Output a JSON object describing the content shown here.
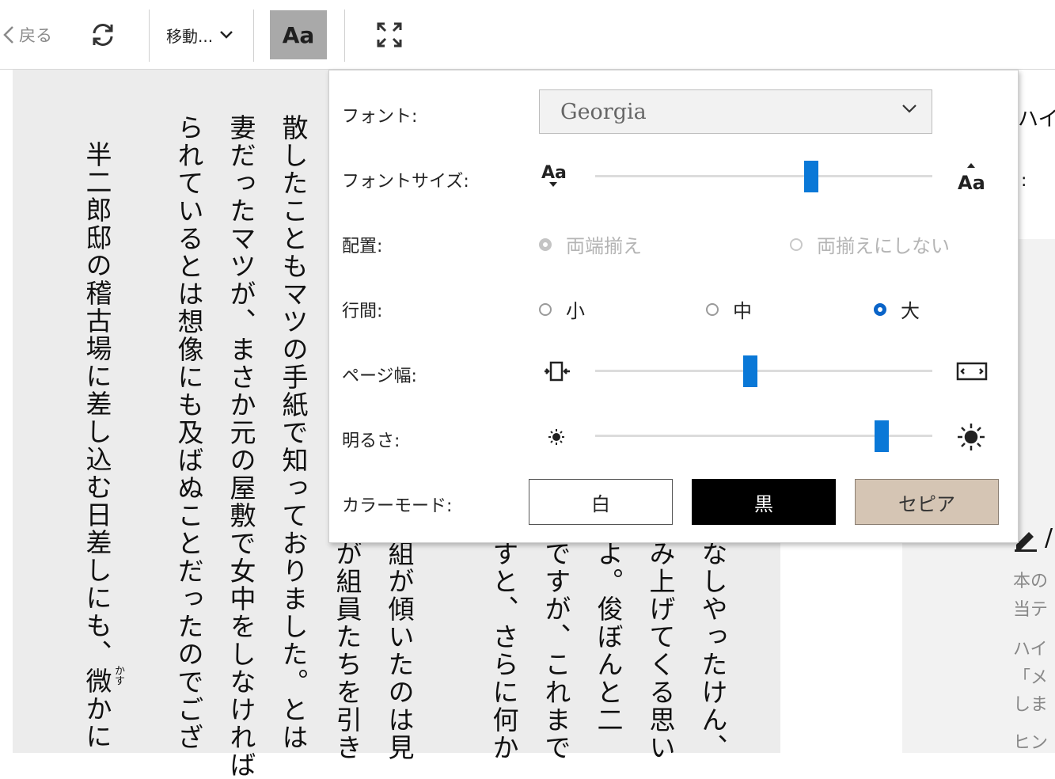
{
  "toolbar": {
    "back_label": "戻る",
    "goto_label": "移動...",
    "format_label": "Aa"
  },
  "page": {
    "columns": [
      "散したこともマツの手紙で知っておりました。とは",
      "妻だったマツが、まさか元の屋敷で女中をしなければ",
      "られているとは想像にも及ばぬことだったのでござ",
      "半二郎邸の稽古場に差し込む日差しにも、微かに",
      "が組員たちを引き",
      "組が傾いたのは見",
      "すと、さらに何か",
      "ですが、これまで",
      "よ。俊ぼんと二",
      "み上げてくる思い",
      "なしやったけん、"
    ],
    "ruby": "かす"
  },
  "side_panel": {
    "top_text_1": "ハイ",
    "top_text_2": ":",
    "lines": [
      "本の",
      "当テ",
      "ハイ",
      "「メ",
      "しま",
      "ヒン"
    ]
  },
  "settings": {
    "font": {
      "label": "フォント:",
      "value": "Georgia"
    },
    "font_size": {
      "label": "フォントサイズ:",
      "value": 0.64
    },
    "alignment": {
      "label": "配置:",
      "options": [
        "両端揃え",
        "両揃えにしない"
      ],
      "selected": 0,
      "disabled": true
    },
    "line_spacing": {
      "label": "行間:",
      "options": [
        "小",
        "中",
        "大"
      ],
      "selected": 2
    },
    "page_width": {
      "label": "ページ幅:",
      "value": 0.46
    },
    "brightness": {
      "label": "明るさ:",
      "value": 0.85
    },
    "color_mode": {
      "label": "カラーモード:",
      "options": [
        "白",
        "黒",
        "セピア"
      ],
      "colors": {
        "white": "#ffffff",
        "black": "#000000",
        "sepia": "#d5c5b4"
      }
    },
    "accent": "#0a78d7"
  }
}
